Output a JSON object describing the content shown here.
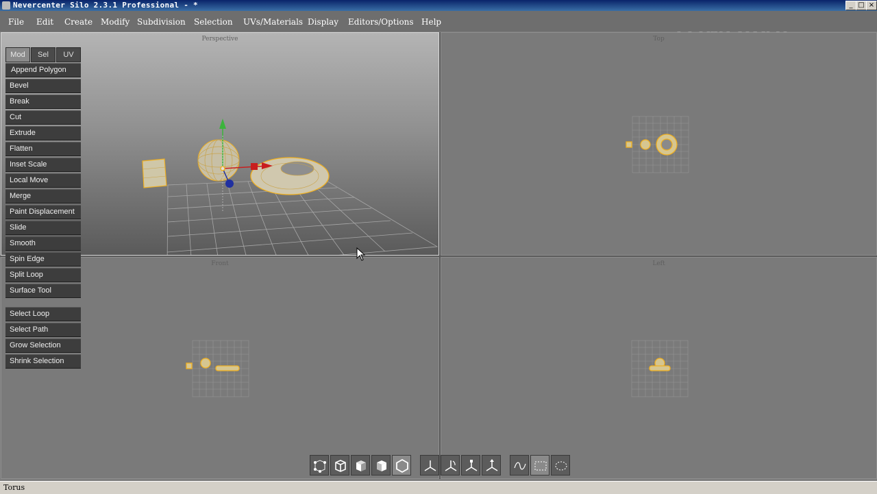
{
  "window": {
    "title": "Nevercenter Silo 2.3.1 Professional - *",
    "controls": {
      "minimize": "_",
      "maximize": "□",
      "close": "×"
    }
  },
  "watermark": "中新金桥",
  "menu": [
    "File",
    "Edit",
    "Create",
    "Modify",
    "Subdivision",
    "Selection",
    "UVs/Materials",
    "Display",
    "Editors/Options",
    "Help"
  ],
  "viewports": {
    "perspective": "Perspective",
    "top": "Top",
    "front": "Front",
    "left": "Left"
  },
  "mode_tabs": {
    "mod": "Mod",
    "sel": "Sel",
    "uv": "UV",
    "active": "Mod"
  },
  "modify_tools": [
    "Append Polygon",
    "Bevel",
    "Break",
    "Cut",
    "Extrude",
    "Flatten",
    "Inset Scale",
    "Local Move",
    "Merge",
    "Paint Displacement",
    "Slide",
    "Smooth",
    "Spin Edge",
    "Split Loop",
    "Surface Tool"
  ],
  "selection_tools": [
    "Select Loop",
    "Select Path",
    "Grow Selection",
    "Shrink Selection"
  ],
  "bottom_toolbar": {
    "selection_modes": [
      "vertex-mode-icon",
      "edge-mode-icon",
      "face-mode-icon",
      "object-mode-icon",
      "object-solid-mode-icon"
    ],
    "manipulators": [
      "move-manipulator-icon",
      "rotate-manipulator-icon",
      "scale-manipulator-icon",
      "universal-manipulator-icon"
    ],
    "select_types": [
      "lasso-select-icon",
      "rectangle-select-icon",
      "paint-select-icon"
    ],
    "active_selection_mode": "object-solid-mode-icon",
    "active_select_type": "rectangle-select-icon"
  },
  "status": {
    "text": "Torus"
  },
  "colors": {
    "accent_yellow": "#f0b020",
    "manip_x": "#c81e1e",
    "manip_y": "#3cb43c",
    "manip_z": "#2030a0"
  }
}
